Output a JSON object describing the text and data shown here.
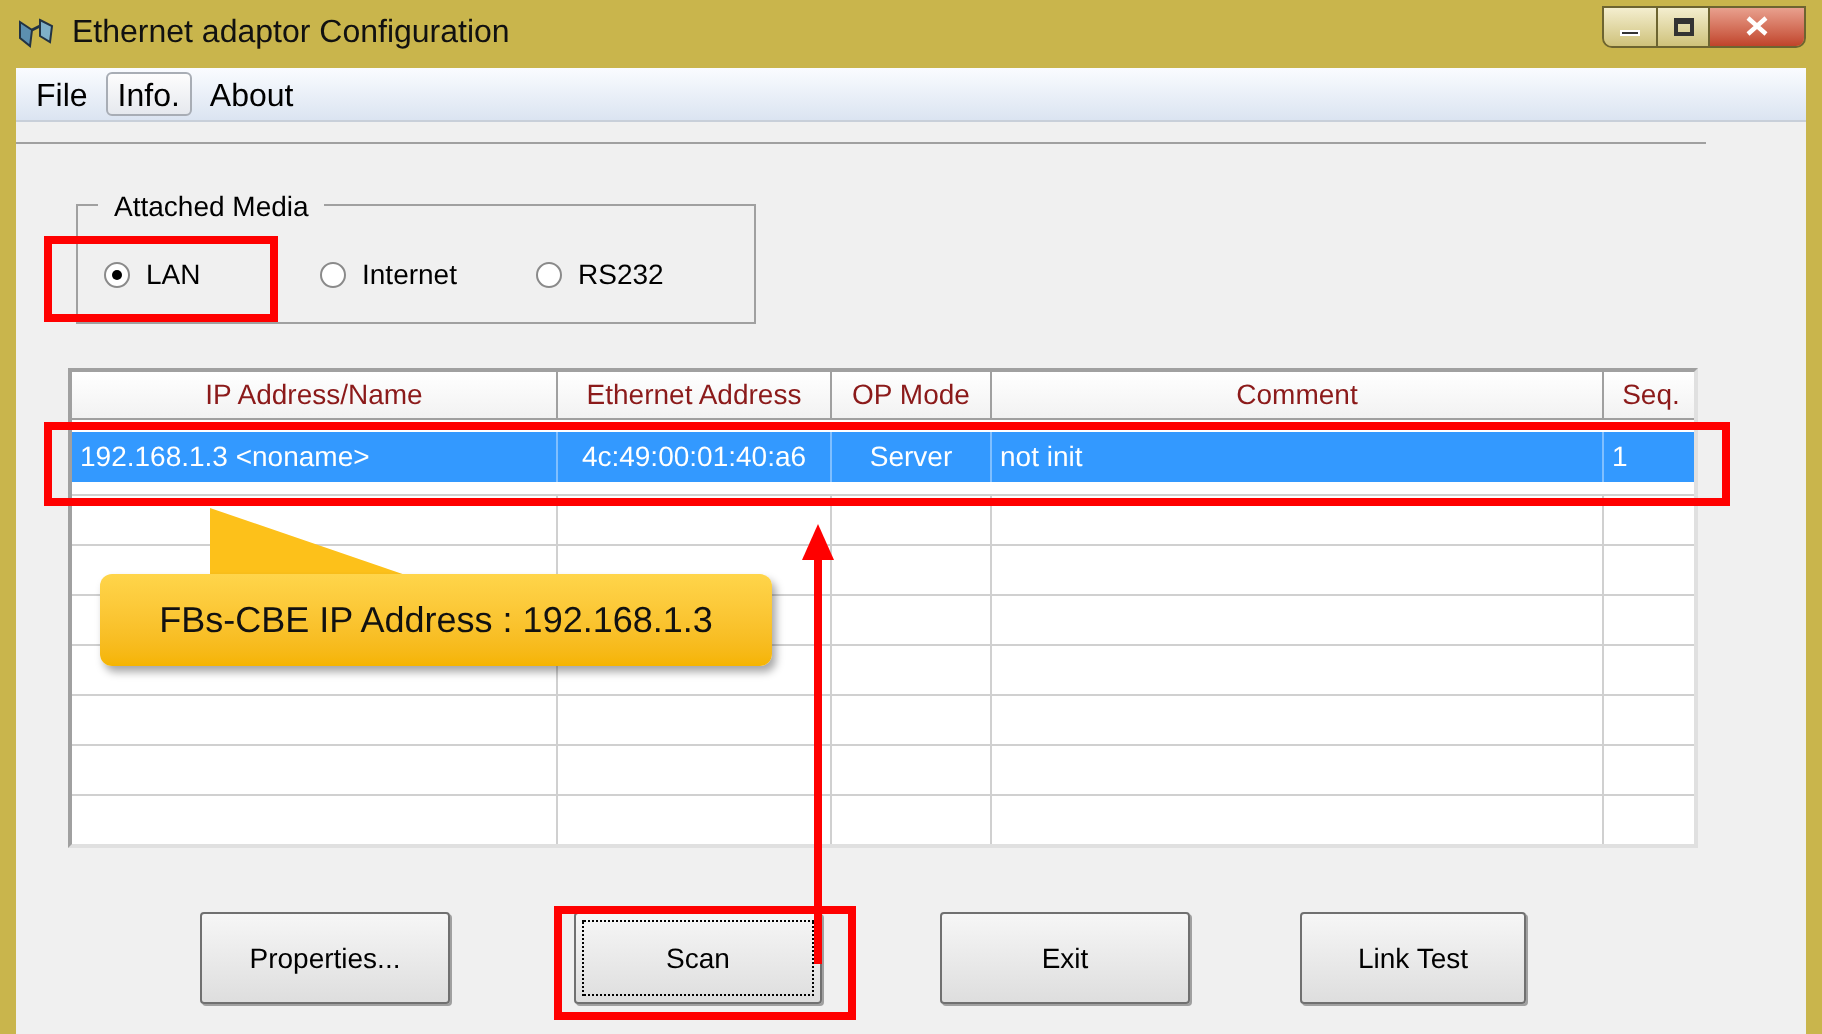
{
  "window": {
    "title": "Ethernet adaptor Configuration"
  },
  "menu": [
    {
      "label": "File",
      "selected": false
    },
    {
      "label": "Info.",
      "selected": true
    },
    {
      "label": "About",
      "selected": false
    }
  ],
  "attached_media": {
    "title": "Attached Media",
    "options": [
      {
        "label": "LAN",
        "selected": true
      },
      {
        "label": "Internet",
        "selected": false
      },
      {
        "label": "RS232",
        "selected": false
      }
    ]
  },
  "table": {
    "columns": [
      "IP Address/Name",
      "Ethernet Address",
      "OP Mode",
      "Comment",
      "Seq."
    ],
    "rows": [
      {
        "cells": [
          "192.168.1.3 <noname>",
          "4c:49:00:01:40:a6",
          "Server",
          "not init",
          "1"
        ],
        "selected": true
      }
    ]
  },
  "buttons": [
    {
      "label": "Properties...",
      "focused": false
    },
    {
      "label": "Scan",
      "focused": true
    },
    {
      "label": "Exit",
      "focused": false
    },
    {
      "label": "Link Test",
      "focused": false
    }
  ],
  "callout": {
    "text": "FBs-CBE IP Address : 192.168.1.3"
  }
}
